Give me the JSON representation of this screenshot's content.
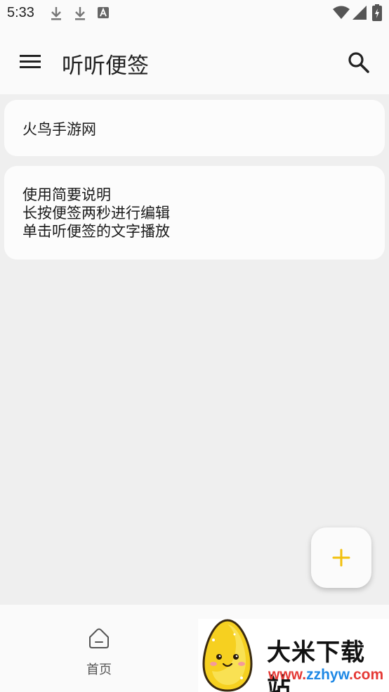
{
  "status_bar": {
    "time": "5:33",
    "left_icons": [
      "download-icon",
      "download-icon",
      "text-a-icon"
    ],
    "right_icons": [
      "wifi-icon",
      "signal-icon",
      "battery-charging-icon"
    ]
  },
  "app_bar": {
    "title": "听听便签",
    "menu_icon": "menu-icon",
    "search_icon": "search-icon"
  },
  "notes": [
    {
      "lines": [
        "火鸟手游网"
      ]
    },
    {
      "lines": [
        "使用简要说明",
        "长按便签两秒进行编辑",
        "单击听便签的文字播放"
      ]
    }
  ],
  "fab": {
    "icon": "plus-icon",
    "color": "#f2c00e"
  },
  "bottom_nav": {
    "items": [
      {
        "label": "首页",
        "icon": "home-icon"
      }
    ]
  },
  "watermark": {
    "title": "大米下载站",
    "url_parts": [
      "www.",
      "zzhyw",
      ".com"
    ],
    "url_colors": [
      "#e53935",
      "#1e88e5",
      "#e53935"
    ]
  },
  "colors": {
    "background": "#efefef",
    "surface": "#fafafa",
    "card": "#fcfcfc",
    "accent": "#f2c00e"
  }
}
